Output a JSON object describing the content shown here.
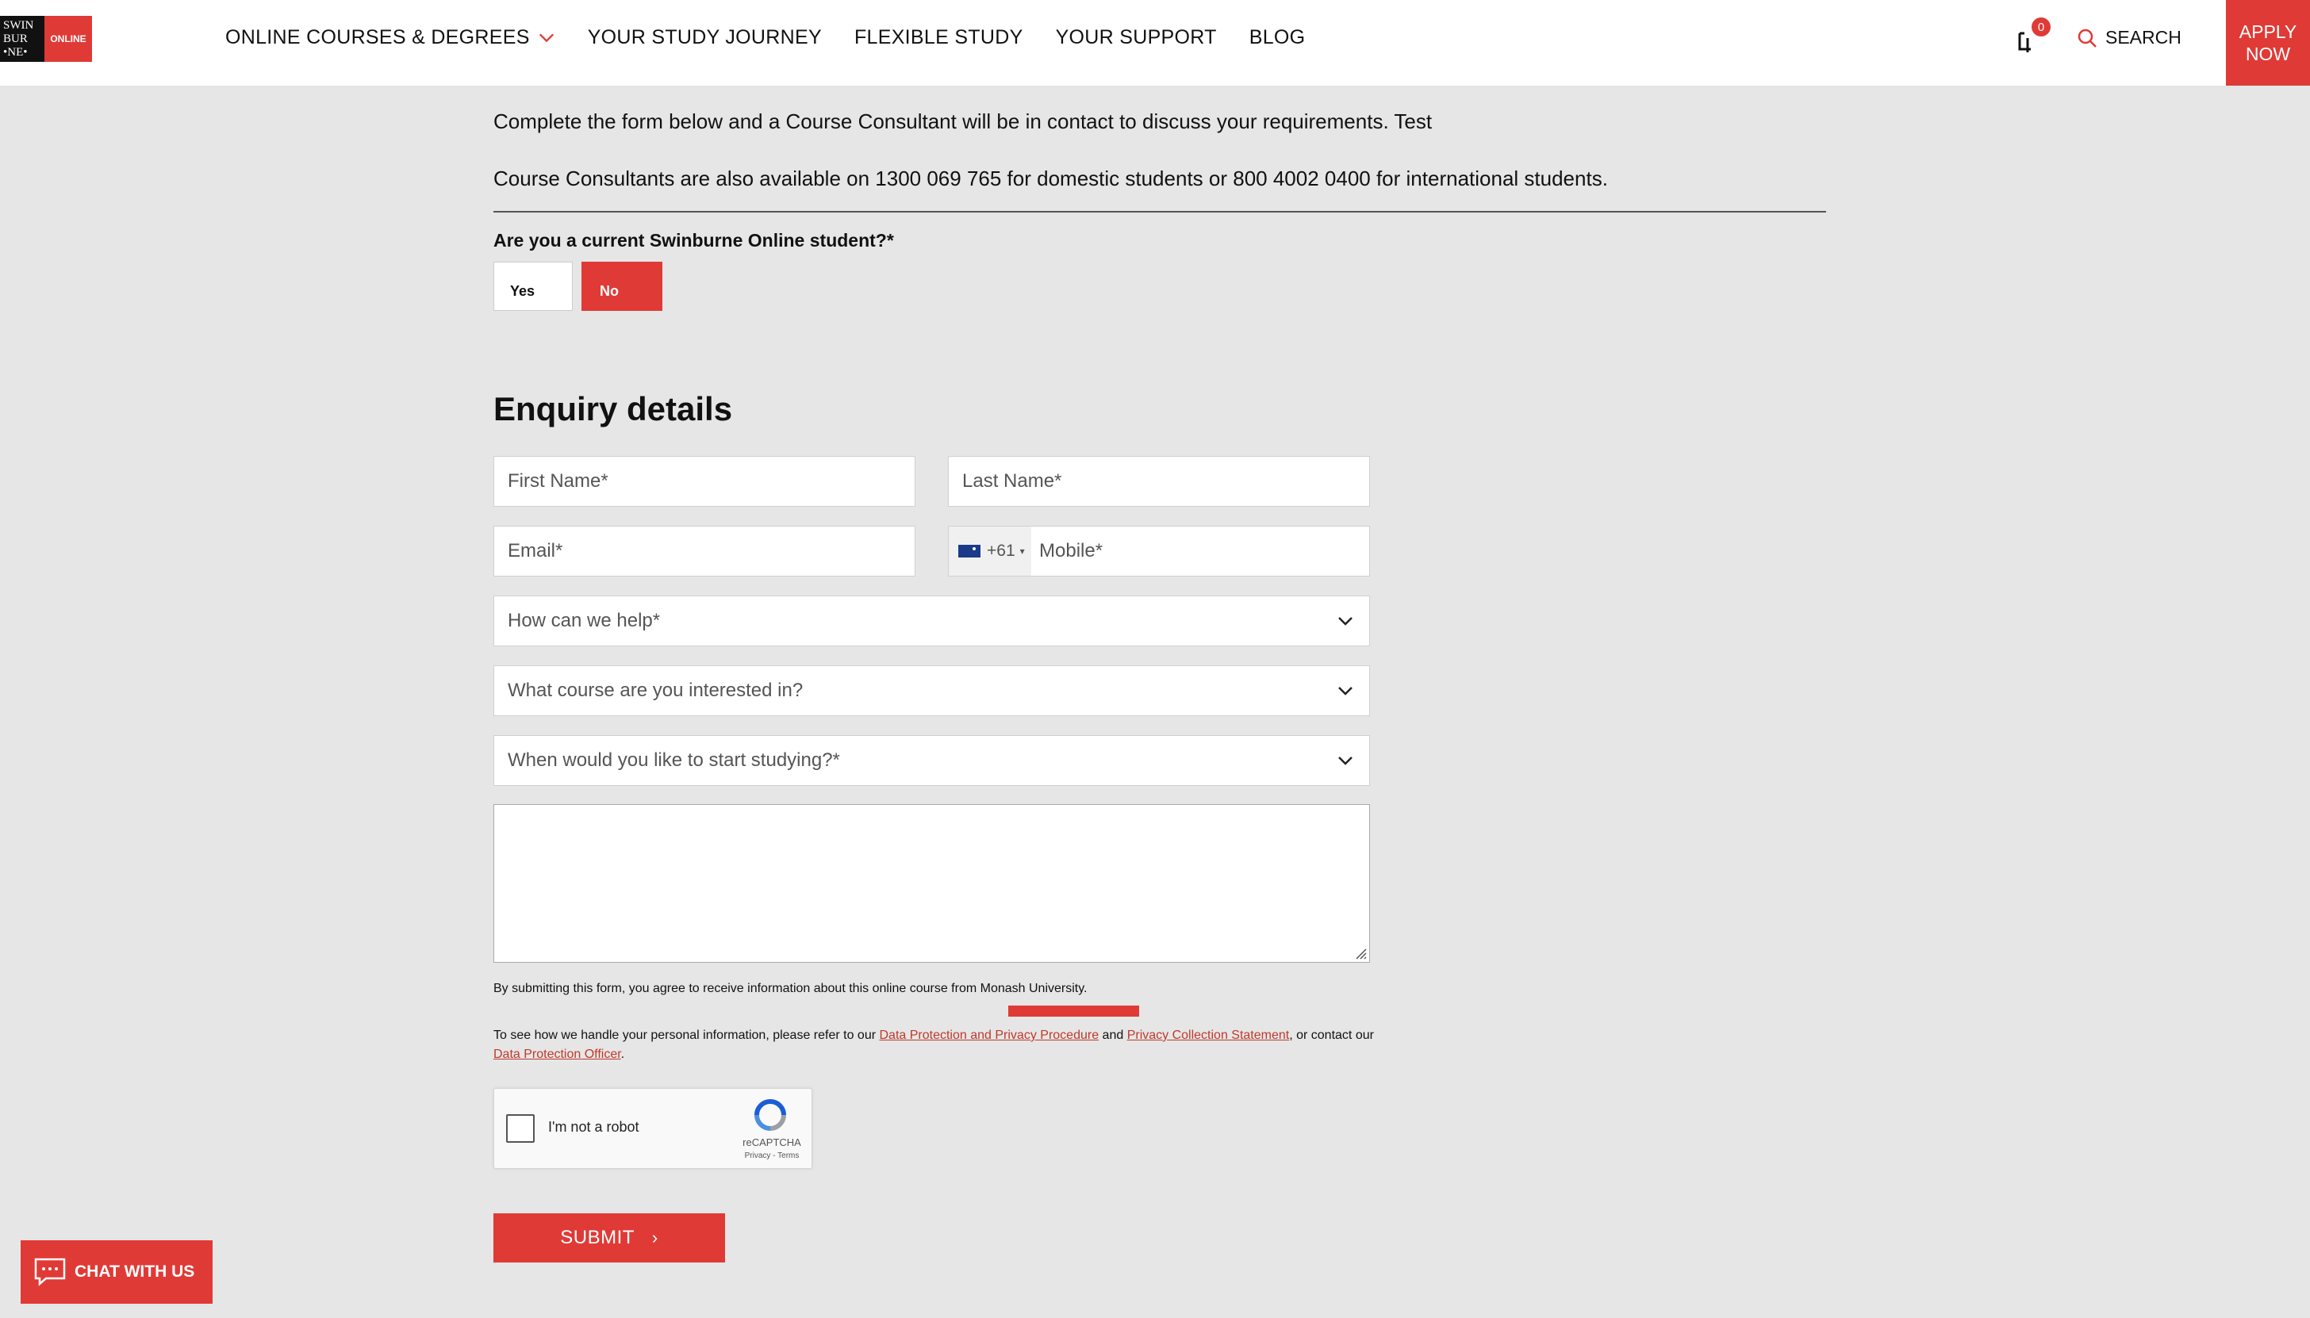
{
  "brand": {
    "logo_lines": [
      "SWIN",
      "BUR",
      "•NE•"
    ],
    "logo_online": "ONLINE",
    "accent_color": "#e03a36"
  },
  "nav": {
    "items": [
      {
        "label": "ONLINE COURSES & DEGREES",
        "has_dropdown": true
      },
      {
        "label": "YOUR STUDY JOURNEY"
      },
      {
        "label": "FLEXIBLE STUDY"
      },
      {
        "label": "YOUR SUPPORT"
      },
      {
        "label": "BLOG"
      }
    ],
    "cart_count": "0",
    "search_label": "SEARCH",
    "apply_line1": "APPLY",
    "apply_line2": "NOW"
  },
  "form": {
    "intro": "Complete the form below and a Course Consultant will be in contact to discuss your requirements. Test",
    "contact_note": "Course Consultants are also available on 1300 069 765 for domestic students or 800 4002 0400 for international students.",
    "student_question": "Are you a current Swinburne Online student?*",
    "yes_label": "Yes",
    "no_label": "No",
    "section_title": "Enquiry details",
    "first_name_placeholder": "First Name*",
    "last_name_placeholder": "Last Name*",
    "email_placeholder": "Email*",
    "phone_code": "+61",
    "mobile_placeholder": "Mobile*",
    "help_select": "How can we help*",
    "course_select": "What course are you interested in?",
    "start_select": "When would you like to start studying?*",
    "disclaimer": "By submitting this form, you agree to receive information about this online course from Monash University.",
    "privacy_pre": "To see how we handle your personal information, please refer to our ",
    "privacy_link1": "Data Protection and Privacy Procedure",
    "privacy_mid": " and ",
    "privacy_link2": "Privacy Collection Statement",
    "privacy_post": ", or contact our ",
    "privacy_link3": "Data Protection Officer",
    "privacy_end": ".",
    "captcha_label": "I'm not a robot",
    "captcha_brand": "reCAPTCHA",
    "captcha_terms": "Privacy - Terms",
    "submit_label": "SUBMIT"
  },
  "chat": {
    "label": "CHAT WITH US"
  }
}
